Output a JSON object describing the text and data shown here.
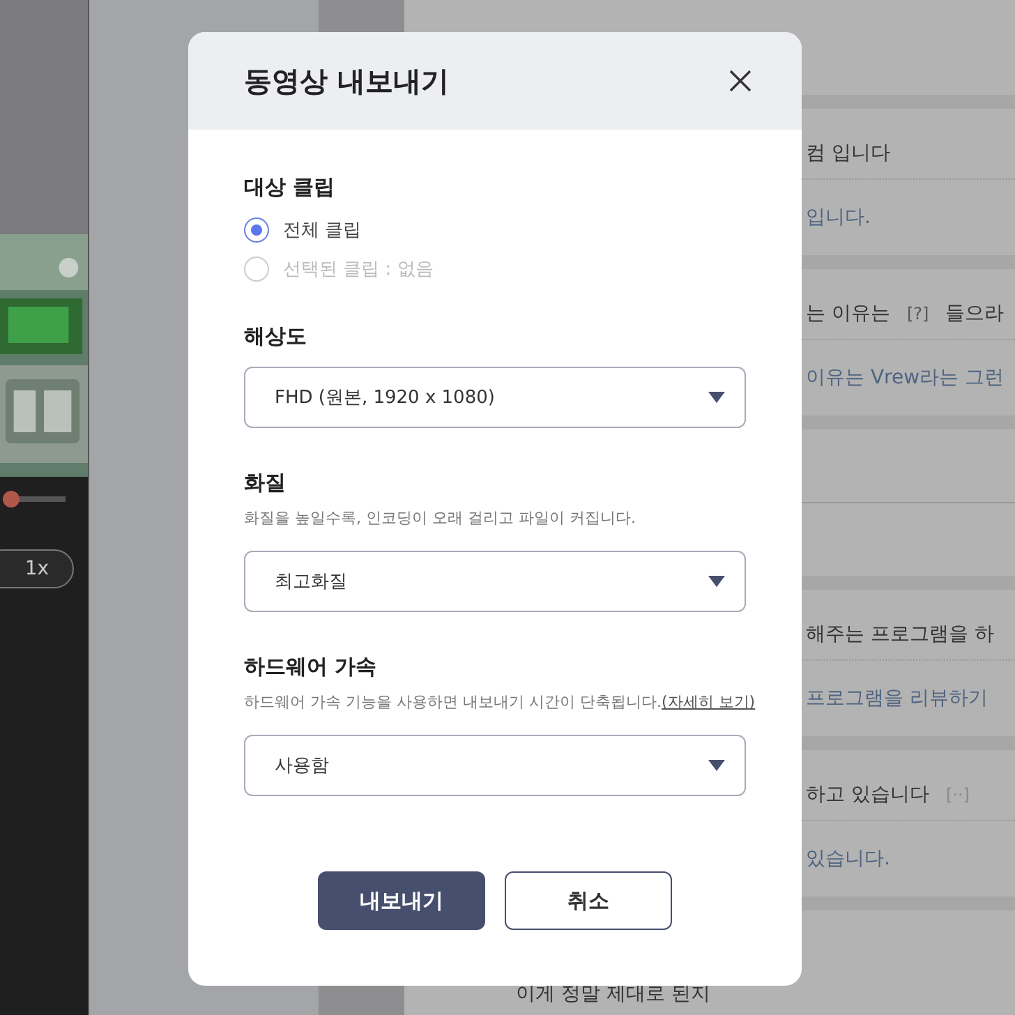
{
  "editor": {
    "speed_button": "1x",
    "playhead": {
      "level": 0.06
    }
  },
  "article": {
    "groups": [
      {
        "lines": [
          {
            "text": "컴  입니다",
            "kind": "plain"
          },
          {
            "text": "입니다.",
            "kind": "link"
          }
        ]
      },
      {
        "lines": [
          {
            "text": "는  이유는",
            "tag": "[?]",
            "rest": "들으라",
            "kind": "plain"
          },
          {
            "text": "이유는 Vrew라는 그런",
            "kind": "link"
          }
        ]
      },
      {
        "kind": "blank"
      },
      {
        "lines": [
          {
            "text": "해주는  프로그램을  하",
            "kind": "plain"
          },
          {
            "text": "프로그램을 리뷰하기",
            "kind": "link"
          }
        ]
      },
      {
        "lines": [
          {
            "text": "하고  있습니다",
            "tag": "[··]",
            "kind": "plain"
          },
          {
            "text": "있습니다.",
            "kind": "link"
          }
        ]
      },
      {
        "lines": [
          {
            "text": "이게  정말  제대로  된지",
            "kind": "plain"
          }
        ]
      }
    ]
  },
  "dialog": {
    "title": "동영상 내보내기",
    "sections": [
      {
        "kind": "radio",
        "title": "대상 클립",
        "options": [
          {
            "label": "전체 클립",
            "selected": true,
            "disabled": false
          },
          {
            "label": "선택된 클립 : 없음",
            "selected": false,
            "disabled": true
          }
        ]
      },
      {
        "kind": "select",
        "title": "해상도",
        "value": "FHD (원본, 1920 x 1080)"
      },
      {
        "kind": "select",
        "title": "화질",
        "description": "화질을 높일수록, 인코딩이 오래 걸리고 파일이 커집니다.",
        "value": "최고화질"
      },
      {
        "kind": "select",
        "title": "하드웨어 가속",
        "description": "하드웨어 가속 기능을 사용하면 내보내기 시간이 단축됩니다.",
        "link": "(자세히 보기)",
        "value": "사용함"
      }
    ],
    "buttons": [
      {
        "label": "내보내기",
        "kind": "primary"
      },
      {
        "label": "취소",
        "kind": "secondary"
      }
    ]
  }
}
